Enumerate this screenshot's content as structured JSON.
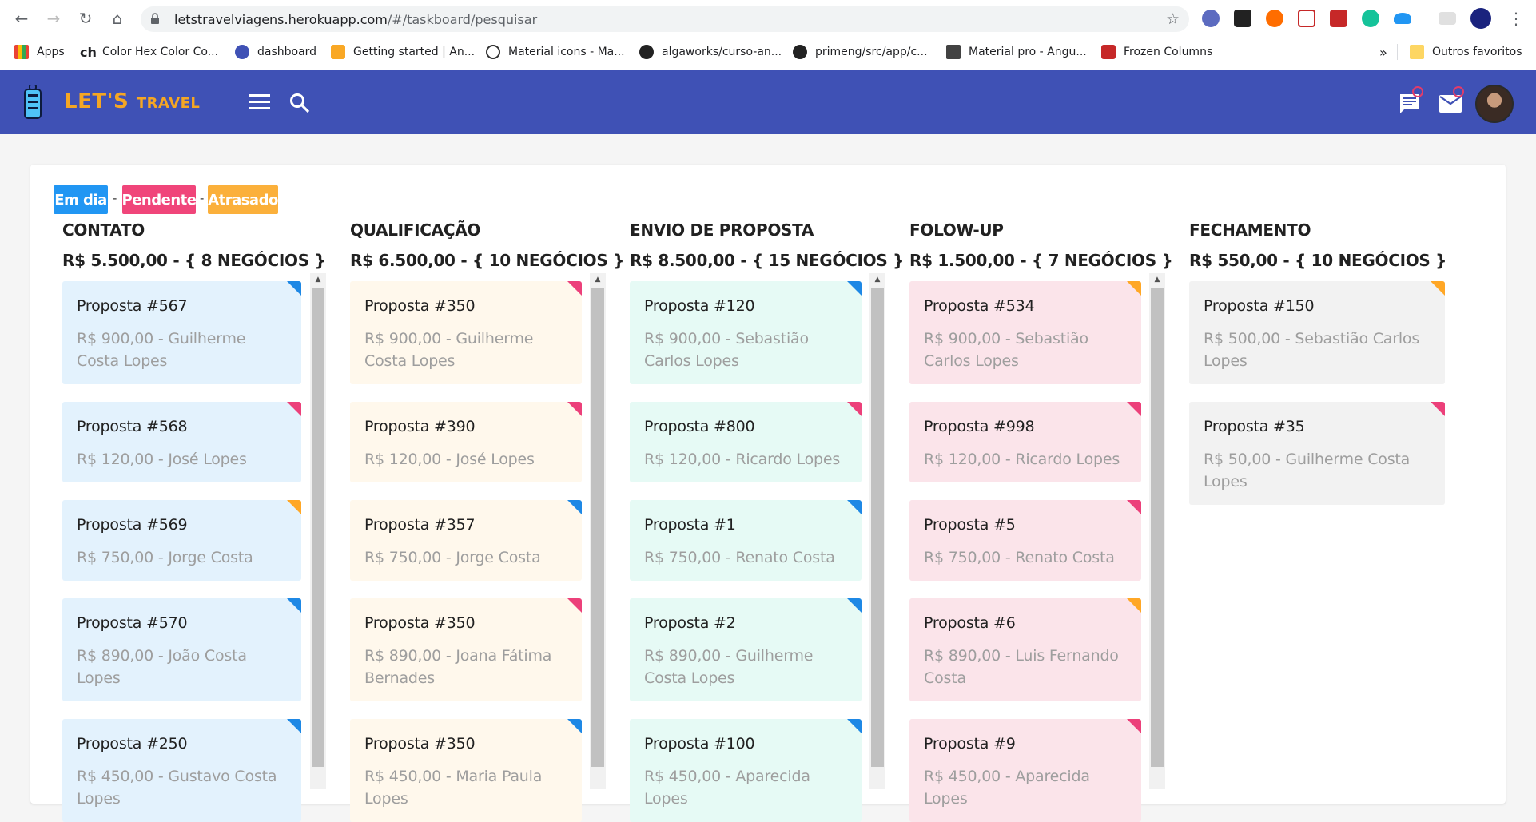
{
  "browser": {
    "url_host": "letstravelviagens.herokuapp.com",
    "url_path": "/#/taskboard/pesquisar",
    "bookmarks": [
      "Apps",
      "Color Hex Color Co...",
      "dashboard",
      "Getting started | An...",
      "Material icons - Ma...",
      "algaworks/curso-an...",
      "primeng/src/app/c...",
      "Material pro - Angu...",
      "Frozen Columns",
      "Outros favoritos"
    ]
  },
  "app": {
    "logo_main": "LET'S",
    "logo_sub": "TRAVEL"
  },
  "legend": {
    "em_dia": "Em dia",
    "pendente": "Pendente",
    "atrasado": "Atrasado",
    "separator": "-"
  },
  "colors": {
    "blue": "#1e88e5",
    "pink": "#ec407a",
    "orange": "#ffa726",
    "appbar": "#3f51b5"
  },
  "columns": [
    {
      "title": "CONTATO",
      "total": "R$ 5.500,00 - { 8 NEGÓCIOS }",
      "cards": [
        {
          "title": "Proposta #567",
          "sub": "R$ 900,00 - Guilherme Costa Lopes",
          "status": "blue"
        },
        {
          "title": "Proposta #568",
          "sub": "R$ 120,00 - José Lopes",
          "status": "pink"
        },
        {
          "title": "Proposta #569",
          "sub": "R$ 750,00 - Jorge Costa",
          "status": "orange"
        },
        {
          "title": "Proposta #570",
          "sub": "R$ 890,00 - João Costa Lopes",
          "status": "blue"
        },
        {
          "title": "Proposta #250",
          "sub": "R$ 450,00 - Gustavo Costa Lopes",
          "status": "blue"
        }
      ]
    },
    {
      "title": "QUALIFICAÇÃO",
      "total": "R$ 6.500,00 - { 10 NEGÓCIOS }",
      "cards": [
        {
          "title": "Proposta #350",
          "sub": "R$ 900,00 - Guilherme Costa Lopes",
          "status": "pink"
        },
        {
          "title": "Proposta #390",
          "sub": "R$ 120,00 - José Lopes",
          "status": "pink"
        },
        {
          "title": "Proposta #357",
          "sub": "R$ 750,00 - Jorge Costa",
          "status": "blue"
        },
        {
          "title": "Proposta #350",
          "sub": "R$ 890,00 - Joana Fátima Bernades",
          "status": "pink"
        },
        {
          "title": "Proposta #350",
          "sub": "R$ 450,00 - Maria Paula Lopes",
          "status": "blue"
        }
      ]
    },
    {
      "title": "ENVIO DE PROPOSTA",
      "total": "R$ 8.500,00 - { 15 NEGÓCIOS }",
      "cards": [
        {
          "title": "Proposta #120",
          "sub": "R$ 900,00 - Sebastião Carlos Lopes",
          "status": "blue"
        },
        {
          "title": "Proposta #800",
          "sub": "R$ 120,00 - Ricardo Lopes",
          "status": "pink"
        },
        {
          "title": "Proposta #1",
          "sub": "R$ 750,00 - Renato Costa",
          "status": "blue"
        },
        {
          "title": "Proposta #2",
          "sub": "R$ 890,00 - Guilherme Costa Lopes",
          "status": "blue"
        },
        {
          "title": "Proposta #100",
          "sub": "R$ 450,00 - Aparecida Lopes",
          "status": "blue"
        }
      ]
    },
    {
      "title": "FOLOW-UP",
      "total": "R$ 1.500,00 - { 7 NEGÓCIOS }",
      "cards": [
        {
          "title": "Proposta #534",
          "sub": "R$ 900,00 - Sebastião Carlos Lopes",
          "status": "orange"
        },
        {
          "title": "Proposta #998",
          "sub": "R$ 120,00 - Ricardo Lopes",
          "status": "pink"
        },
        {
          "title": "Proposta #5",
          "sub": "R$ 750,00 - Renato Costa",
          "status": "pink"
        },
        {
          "title": "Proposta #6",
          "sub": "R$ 890,00 - Luis Fernando Costa",
          "status": "orange"
        },
        {
          "title": "Proposta #9",
          "sub": "R$ 450,00 - Aparecida Lopes",
          "status": "pink"
        }
      ]
    },
    {
      "title": "FECHAMENTO",
      "total": "R$ 550,00 - { 10 NEGÓCIOS }",
      "cards": [
        {
          "title": "Proposta #150",
          "sub": "R$ 500,00 - Sebastião Carlos Lopes",
          "status": "orange"
        },
        {
          "title": "Proposta #35",
          "sub": "R$ 50,00 - Guilherme Costa Lopes",
          "status": "pink"
        }
      ]
    }
  ]
}
